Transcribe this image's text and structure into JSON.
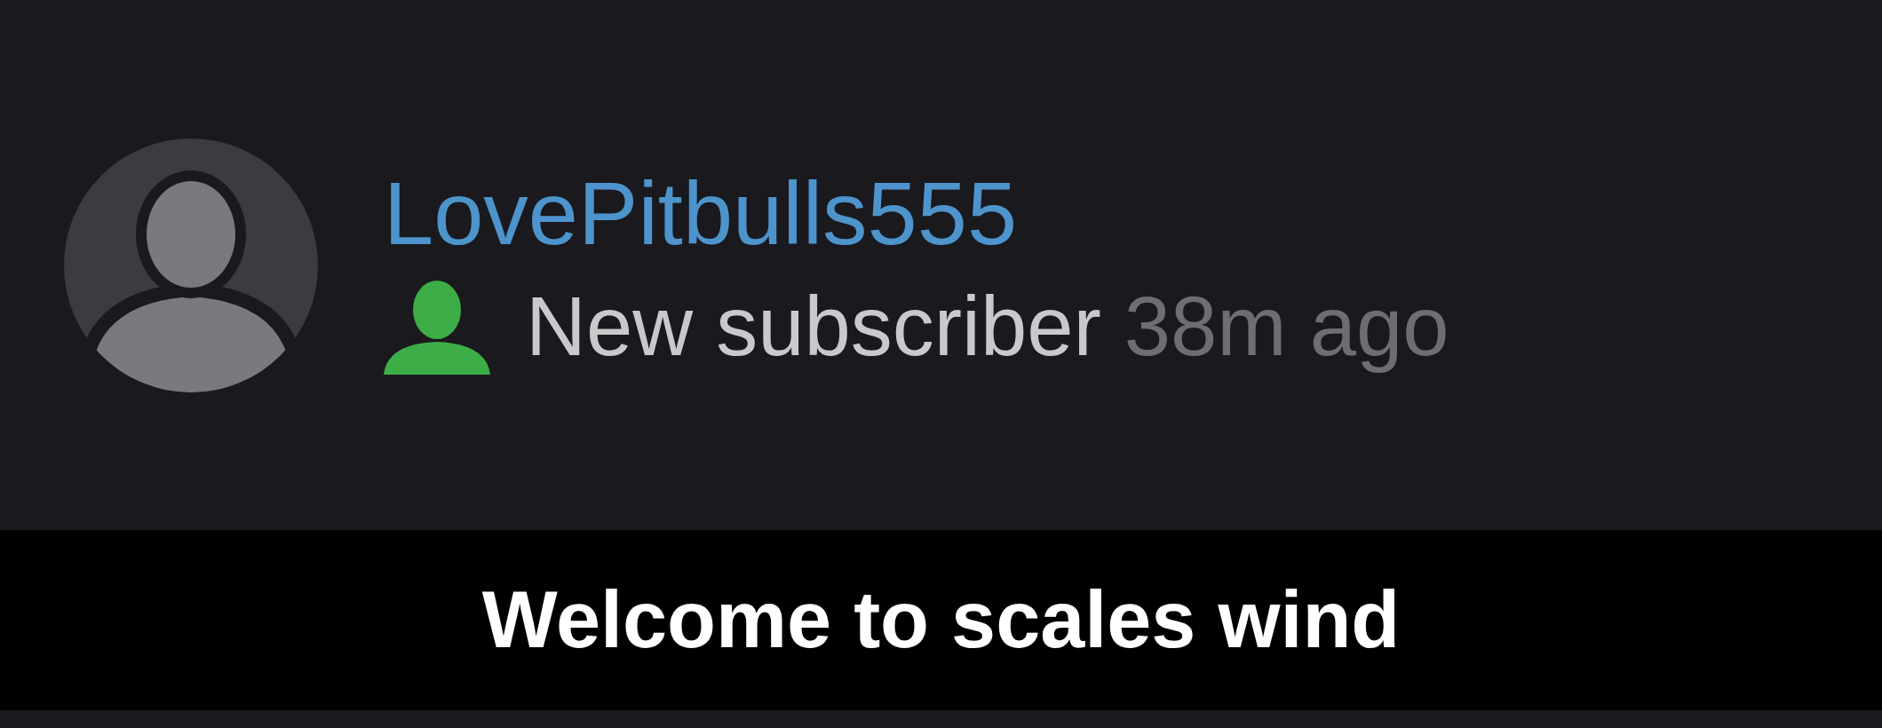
{
  "notification": {
    "username": "LovePitbulls555",
    "event": "New subscriber",
    "time": "38m ago"
  },
  "caption": "Welcome to scales wind"
}
